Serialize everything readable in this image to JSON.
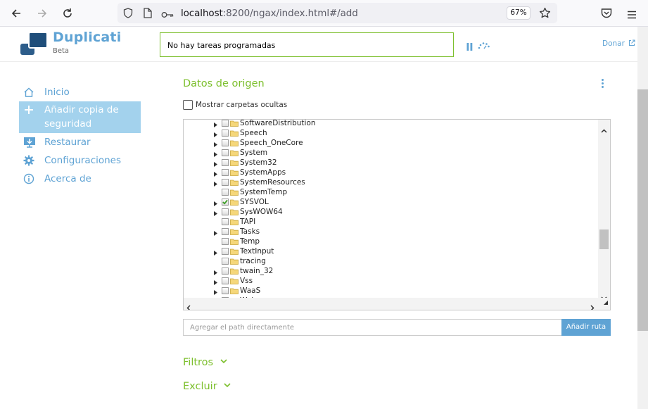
{
  "browser": {
    "url_host": "localhost",
    "url_rest": ":8200/ngax/index.html#/add",
    "zoom": "67%"
  },
  "header": {
    "brand": "Duplicati",
    "brand_sub": "Beta",
    "status": "No hay tareas programadas",
    "donate": "Donar"
  },
  "sidebar": {
    "items": [
      {
        "label": "Inicio",
        "icon": "home-icon"
      },
      {
        "label": "Añadir copia de seguridad",
        "icon": "plus-icon"
      },
      {
        "label": "Restaurar",
        "icon": "restore-icon"
      },
      {
        "label": "Configuraciones",
        "icon": "gear-icon"
      },
      {
        "label": "Acerca de",
        "icon": "info-icon"
      }
    ]
  },
  "main": {
    "title": "Datos de origen",
    "show_hidden": "Mostrar carpetas ocultas",
    "tree": [
      {
        "name": "SoftwareDistribution",
        "expandable": true,
        "checked": false
      },
      {
        "name": "Speech",
        "expandable": true,
        "checked": false
      },
      {
        "name": "Speech_OneCore",
        "expandable": true,
        "checked": false
      },
      {
        "name": "System",
        "expandable": true,
        "checked": false
      },
      {
        "name": "System32",
        "expandable": true,
        "checked": false
      },
      {
        "name": "SystemApps",
        "expandable": true,
        "checked": false
      },
      {
        "name": "SystemResources",
        "expandable": true,
        "checked": false
      },
      {
        "name": "SystemTemp",
        "expandable": false,
        "checked": false
      },
      {
        "name": "SYSVOL",
        "expandable": true,
        "checked": true
      },
      {
        "name": "SysWOW64",
        "expandable": true,
        "checked": false
      },
      {
        "name": "TAPI",
        "expandable": false,
        "checked": false
      },
      {
        "name": "Tasks",
        "expandable": true,
        "checked": false
      },
      {
        "name": "Temp",
        "expandable": false,
        "checked": false
      },
      {
        "name": "TextInput",
        "expandable": true,
        "checked": false
      },
      {
        "name": "tracing",
        "expandable": false,
        "checked": false
      },
      {
        "name": "twain_32",
        "expandable": true,
        "checked": false
      },
      {
        "name": "Vss",
        "expandable": true,
        "checked": false
      },
      {
        "name": "WaaS",
        "expandable": true,
        "checked": false
      },
      {
        "name": "Web",
        "expandable": true,
        "checked": false
      }
    ],
    "path_placeholder": "Agregar el path directamente",
    "add_path": "Añadir ruta",
    "filters": "Filtros",
    "exclude": "Excluir"
  }
}
